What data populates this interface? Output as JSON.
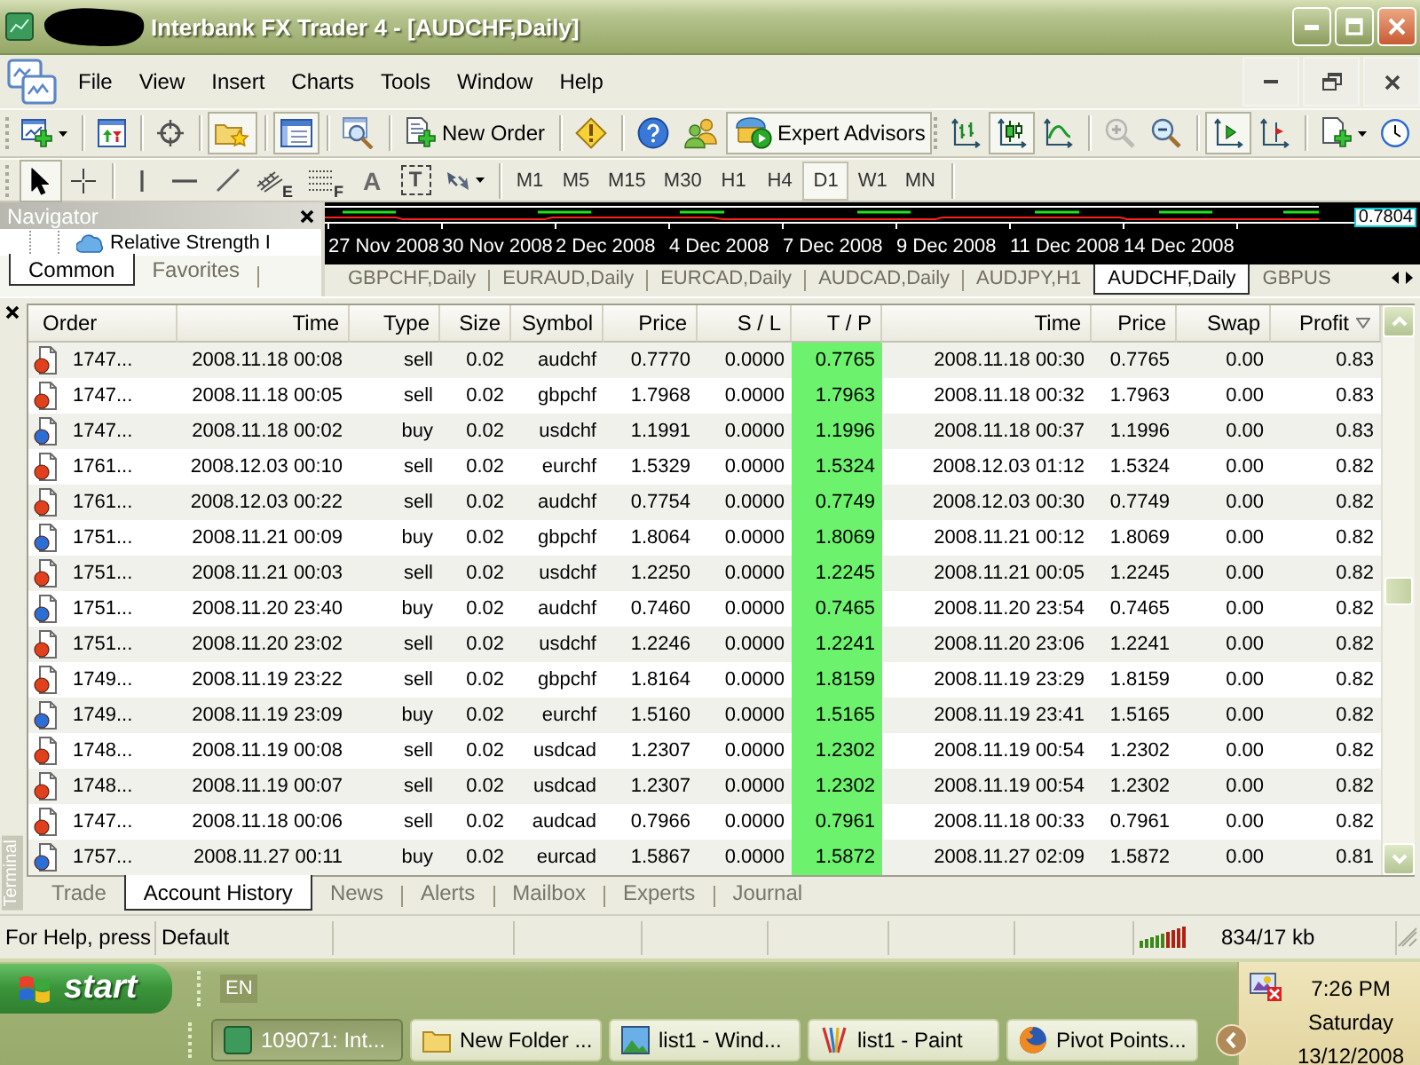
{
  "window": {
    "title": "Interbank FX Trader 4 - [AUDCHF,Daily]"
  },
  "menu": [
    "File",
    "View",
    "Insert",
    "Charts",
    "Tools",
    "Window",
    "Help"
  ],
  "toolbar": {
    "navigator_on": true,
    "terminal_on": true,
    "new_order_label": "New Order",
    "expert_advisors_label": "Expert Advisors",
    "expert_advisors_on": true,
    "bar_chart_on": false,
    "candlesticks_on": true,
    "line_chart_on": false,
    "zoom_in_disabled": true,
    "zoom_out_disabled": false,
    "auto_scroll_on": true,
    "chart_shift_on": false
  },
  "drawing_toolbar": {
    "cursor_on": true,
    "crosshair_on": false,
    "channel_letter": "E",
    "fibonacci_letter": "F",
    "text_letter": "A",
    "label_letter": "T"
  },
  "periods": [
    {
      "label": "M1",
      "selected": false
    },
    {
      "label": "M5",
      "selected": false
    },
    {
      "label": "M15",
      "selected": false
    },
    {
      "label": "M30",
      "selected": false
    },
    {
      "label": "H1",
      "selected": false
    },
    {
      "label": "H4",
      "selected": false
    },
    {
      "label": "D1",
      "selected": true
    },
    {
      "label": "W1",
      "selected": false
    },
    {
      "label": "MN",
      "selected": false
    }
  ],
  "navigator": {
    "title": "Navigator",
    "item": "Relative Strength I",
    "tabs": [
      {
        "label": "Common",
        "selected": true
      },
      {
        "label": "Favorites",
        "selected": false
      }
    ]
  },
  "chart": {
    "dates": [
      "27 Nov 2008",
      "30 Nov 2008",
      "2 Dec 2008",
      "4 Dec 2008",
      "7 Dec 2008",
      "9 Dec 2008",
      "11 Dec 2008",
      "14 Dec 2008"
    ],
    "price_label": "0.7804"
  },
  "chart_tabs": [
    {
      "label": "GBPCHF,Daily",
      "selected": false
    },
    {
      "label": "EURAUD,Daily",
      "selected": false
    },
    {
      "label": "EURCAD,Daily",
      "selected": false
    },
    {
      "label": "AUDCAD,Daily",
      "selected": false
    },
    {
      "label": "AUDJPY,H1",
      "selected": false
    },
    {
      "label": "AUDCHF,Daily",
      "selected": true
    },
    {
      "label": "GBPUS",
      "selected": false
    }
  ],
  "terminal": {
    "label": "Terminal",
    "columns": [
      "Order",
      "Time",
      "Type",
      "Size",
      "Symbol",
      "Price",
      "S / L",
      "T / P",
      "Time",
      "Price",
      "Swap",
      "Profit"
    ],
    "rows": [
      {
        "kind": "sell",
        "tp_hit": true,
        "cells": [
          "1747...",
          "2008.11.18 00:08",
          "sell",
          "0.02",
          "audchf",
          "0.7770",
          "0.0000",
          "0.7765",
          "2008.11.18 00:30",
          "0.7765",
          "0.00",
          "0.83"
        ]
      },
      {
        "kind": "sell",
        "tp_hit": true,
        "cells": [
          "1747...",
          "2008.11.18 00:05",
          "sell",
          "0.02",
          "gbpchf",
          "1.7968",
          "0.0000",
          "1.7963",
          "2008.11.18 00:32",
          "1.7963",
          "0.00",
          "0.83"
        ]
      },
      {
        "kind": "buy",
        "tp_hit": true,
        "cells": [
          "1747...",
          "2008.11.18 00:02",
          "buy",
          "0.02",
          "usdchf",
          "1.1991",
          "0.0000",
          "1.1996",
          "2008.11.18 00:37",
          "1.1996",
          "0.00",
          "0.83"
        ]
      },
      {
        "kind": "sell",
        "tp_hit": true,
        "cells": [
          "1761...",
          "2008.12.03 00:10",
          "sell",
          "0.02",
          "eurchf",
          "1.5329",
          "0.0000",
          "1.5324",
          "2008.12.03 01:12",
          "1.5324",
          "0.00",
          "0.82"
        ]
      },
      {
        "kind": "sell",
        "tp_hit": true,
        "cells": [
          "1761...",
          "2008.12.03 00:22",
          "sell",
          "0.02",
          "audchf",
          "0.7754",
          "0.0000",
          "0.7749",
          "2008.12.03 00:30",
          "0.7749",
          "0.00",
          "0.82"
        ]
      },
      {
        "kind": "buy",
        "tp_hit": true,
        "cells": [
          "1751...",
          "2008.11.21 00:09",
          "buy",
          "0.02",
          "gbpchf",
          "1.8064",
          "0.0000",
          "1.8069",
          "2008.11.21 00:12",
          "1.8069",
          "0.00",
          "0.82"
        ]
      },
      {
        "kind": "sell",
        "tp_hit": true,
        "cells": [
          "1751...",
          "2008.11.21 00:03",
          "sell",
          "0.02",
          "usdchf",
          "1.2250",
          "0.0000",
          "1.2245",
          "2008.11.21 00:05",
          "1.2245",
          "0.00",
          "0.82"
        ]
      },
      {
        "kind": "buy",
        "tp_hit": true,
        "cells": [
          "1751...",
          "2008.11.20 23:40",
          "buy",
          "0.02",
          "audchf",
          "0.7460",
          "0.0000",
          "0.7465",
          "2008.11.20 23:54",
          "0.7465",
          "0.00",
          "0.82"
        ]
      },
      {
        "kind": "sell",
        "tp_hit": true,
        "cells": [
          "1751...",
          "2008.11.20 23:02",
          "sell",
          "0.02",
          "usdchf",
          "1.2246",
          "0.0000",
          "1.2241",
          "2008.11.20 23:06",
          "1.2241",
          "0.00",
          "0.82"
        ]
      },
      {
        "kind": "sell",
        "tp_hit": true,
        "cells": [
          "1749...",
          "2008.11.19 23:22",
          "sell",
          "0.02",
          "gbpchf",
          "1.8164",
          "0.0000",
          "1.8159",
          "2008.11.19 23:29",
          "1.8159",
          "0.00",
          "0.82"
        ]
      },
      {
        "kind": "buy",
        "tp_hit": true,
        "cells": [
          "1749...",
          "2008.11.19 23:09",
          "buy",
          "0.02",
          "eurchf",
          "1.5160",
          "0.0000",
          "1.5165",
          "2008.11.19 23:41",
          "1.5165",
          "0.00",
          "0.82"
        ]
      },
      {
        "kind": "sell",
        "tp_hit": true,
        "cells": [
          "1748...",
          "2008.11.19 00:08",
          "sell",
          "0.02",
          "usdcad",
          "1.2307",
          "0.0000",
          "1.2302",
          "2008.11.19 00:54",
          "1.2302",
          "0.00",
          "0.82"
        ]
      },
      {
        "kind": "sell",
        "tp_hit": true,
        "cells": [
          "1748...",
          "2008.11.19 00:07",
          "sell",
          "0.02",
          "usdcad",
          "1.2307",
          "0.0000",
          "1.2302",
          "2008.11.19 00:54",
          "1.2302",
          "0.00",
          "0.82"
        ]
      },
      {
        "kind": "sell",
        "tp_hit": true,
        "cells": [
          "1747...",
          "2008.11.18 00:06",
          "sell",
          "0.02",
          "audcad",
          "0.7966",
          "0.0000",
          "0.7961",
          "2008.11.18 00:33",
          "0.7961",
          "0.00",
          "0.82"
        ]
      },
      {
        "kind": "buy",
        "tp_hit": true,
        "cells": [
          "1757...",
          "2008.11.27 00:11",
          "buy",
          "0.02",
          "eurcad",
          "1.5867",
          "0.0000",
          "1.5872",
          "2008.11.27 02:09",
          "1.5872",
          "0.00",
          "0.81"
        ]
      }
    ],
    "tabs": [
      {
        "label": "Trade",
        "selected": false
      },
      {
        "label": "Account History",
        "selected": true
      },
      {
        "label": "News",
        "selected": false
      },
      {
        "label": "Alerts",
        "selected": false
      },
      {
        "label": "Mailbox",
        "selected": false
      },
      {
        "label": "Experts",
        "selected": false
      },
      {
        "label": "Journal",
        "selected": false
      }
    ]
  },
  "status_bar": {
    "help": "For Help, press",
    "profile": "Default",
    "traffic": "834/17 kb"
  },
  "taskbar": {
    "start": "start",
    "language": "EN",
    "tasks": [
      {
        "label": "109071: Int...",
        "selected": true
      },
      {
        "label": "New Folder ...",
        "selected": false
      },
      {
        "label": "list1 - Wind...",
        "selected": false
      },
      {
        "label": "list1 - Paint",
        "selected": false
      },
      {
        "label": "Pivot Points...",
        "selected": false
      }
    ],
    "clock": {
      "time": "7:26 PM",
      "day": "Saturday",
      "date": "13/12/2008"
    }
  }
}
